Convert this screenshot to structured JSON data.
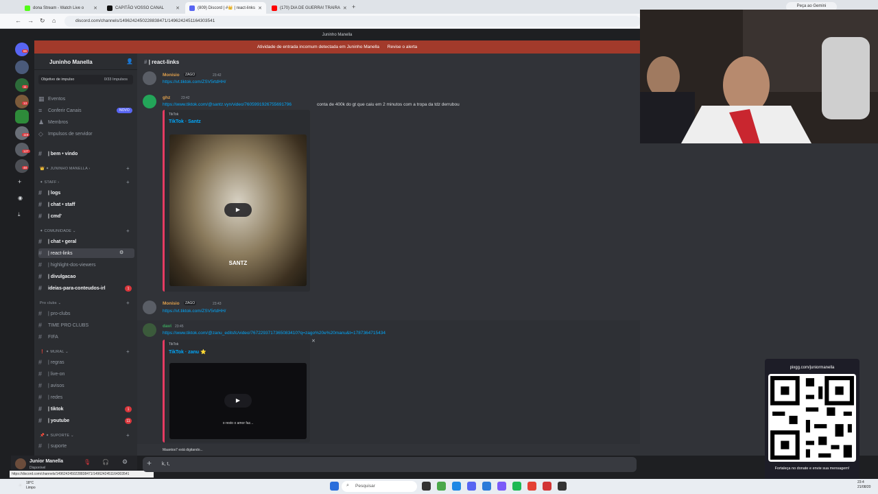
{
  "browser": {
    "tabs": [
      {
        "label": "dona Stream - Watch Live o",
        "color": "#53fc18"
      },
      {
        "label": "CAPITÃO VOSSO CANAL",
        "color": "#111111"
      },
      {
        "label": "(809) Discord | #👑 | react-links",
        "color": "#5865f2"
      },
      {
        "label": "(170) DIA DE GUERRA! TRAIRA",
        "color": "#ff0000"
      }
    ],
    "url": "discord.com/channels/1496242450228838471/1496242451164303541",
    "gemini_button": "Peça ao Gemini",
    "status_url": "https://discord.com/channels/1496242450228838471/1496242451164303541"
  },
  "server": {
    "banner": "Juninho Manella",
    "alert": "Atividade de entrada incomum detectada em Juninho Manella",
    "alert_action": "Revise o alerta",
    "name": "Juninho Manella",
    "boost_label": "Objetivo de impulso",
    "boost_count": "0/33 Impulsos"
  },
  "rail_badges": [
    "86",
    "11",
    "13",
    "119",
    "127",
    "48"
  ],
  "sidebar": {
    "top_items": [
      "Eventos",
      "Conferir Canais",
      "Membros",
      "Impulsos de servidor"
    ],
    "new_pill": "NOVO",
    "bem_vindo": "| bem • vindo",
    "categories": [
      "JUNINHO MANELLA",
      "STAFF",
      "COMUNIDADE",
      "Pro clubs",
      "MURAL",
      "SUPORTE"
    ],
    "staff": [
      "| logs",
      "| chat • staff",
      "| cmd'"
    ],
    "comunidade": [
      "| chat • geral",
      "| react-links",
      "| highlight-dos-viewers",
      "| divulgacao",
      "ideias-para-conteudos-irl"
    ],
    "proclubs": [
      "| pro-clubs",
      "TIME PRO CLUBS",
      "FIFA"
    ],
    "mural": [
      "| regras",
      "| live-on",
      "| avisos",
      "| redes",
      "| tiktok",
      "| youtube"
    ],
    "suporte": [
      "| suporte"
    ],
    "badges": {
      "ideias": "1",
      "tiktok": "1",
      "youtube": "11"
    }
  },
  "user": {
    "name": "Junior Manella",
    "status": "Disponível"
  },
  "channel": {
    "name": "| react-links"
  },
  "messages": {
    "m1": {
      "author": "Monisio",
      "tag": "ZAGO",
      "time": "23:42",
      "link": "https://vt.tiktok.com/ZSV5rtdHH/"
    },
    "m2": {
      "author": "ghz",
      "time": "23:42",
      "link": "https://www.tiktok.com/@santz.vyn/video/7605991926755691796",
      "text": "conta de 400k do gt que caiu em 2 minutos com a tropa da tdz derrubou",
      "embed_provider": "TikTok",
      "embed_title": "TikTok · Santz",
      "thumb_text": "SANTZ"
    },
    "m3": {
      "author": "Monisio",
      "tag": "ZAGO",
      "time": "23:43",
      "link": "https://vt.tiktok.com/ZSV5rtdHH/"
    },
    "m4": {
      "author": "davi",
      "time": "23:45",
      "link": "https://www.tiktok.com/@zanu_editsfc/video/7672293717365083410?q=zago%20e%20manu&t=1787364715434",
      "embed_provider": "TikTok",
      "embed_title": "TikTok · zanu ⭐",
      "thumb_caption": "o resto o amor faz..."
    }
  },
  "typing": "Maantos7 está digitando...",
  "composer_text": "k, t,",
  "qr": {
    "top": "pixgg.com/juniormanella",
    "bottom": "Fortaleça no donate e envie sua mensagem!"
  },
  "taskbar": {
    "temp": "18°C",
    "weather": "Limpo",
    "search": "Pesquisar",
    "time": "23:4",
    "date": "21/08/20"
  }
}
